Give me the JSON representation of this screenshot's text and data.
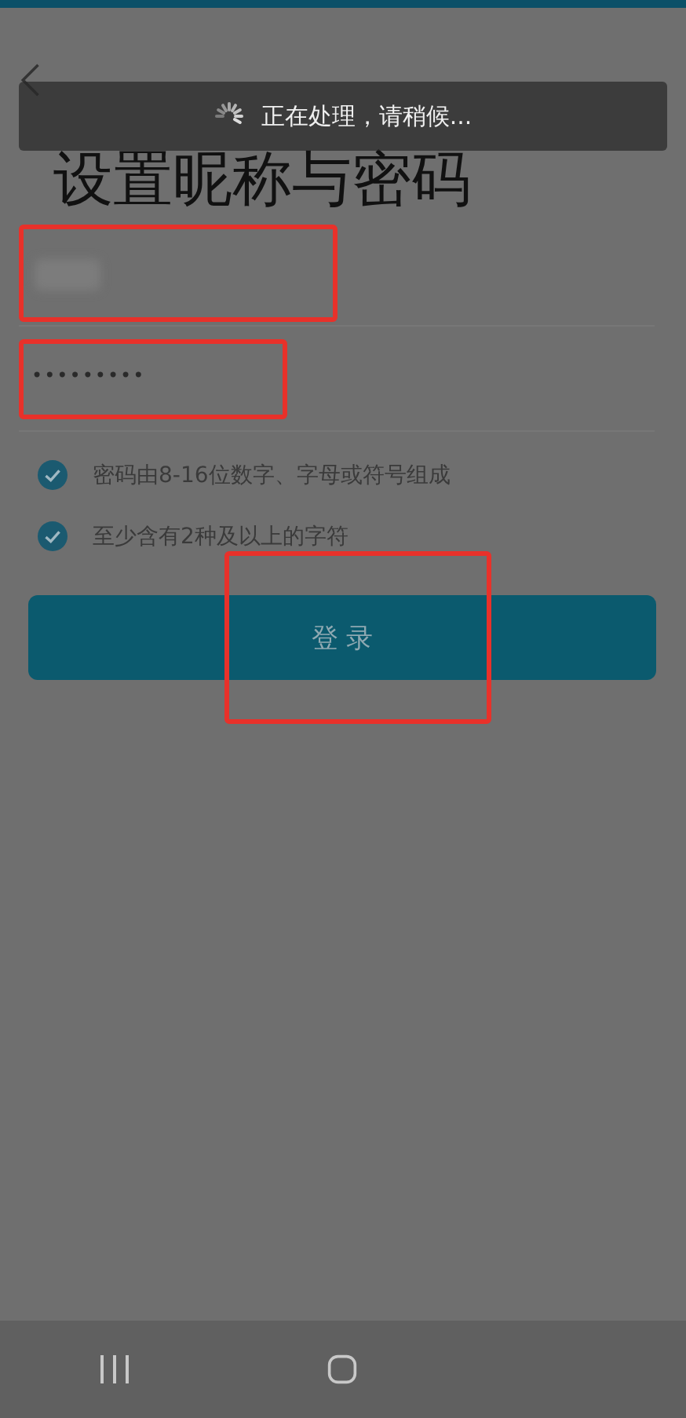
{
  "header": {
    "title": "设置昵称与密码"
  },
  "toast": {
    "text": "正在处理，请稍候...",
    "loading": true
  },
  "nickname_field": {
    "blurred": true,
    "highlighted": true
  },
  "password_field": {
    "value": "•••••••••",
    "highlighted": true
  },
  "rules": [
    {
      "text": "密码由8-16位数字、字母或符号组成",
      "checked": true
    },
    {
      "text": "至少含有2种及以上的字符",
      "checked": true
    }
  ],
  "login_button": {
    "label": "登 录",
    "highlighted": true
  }
}
